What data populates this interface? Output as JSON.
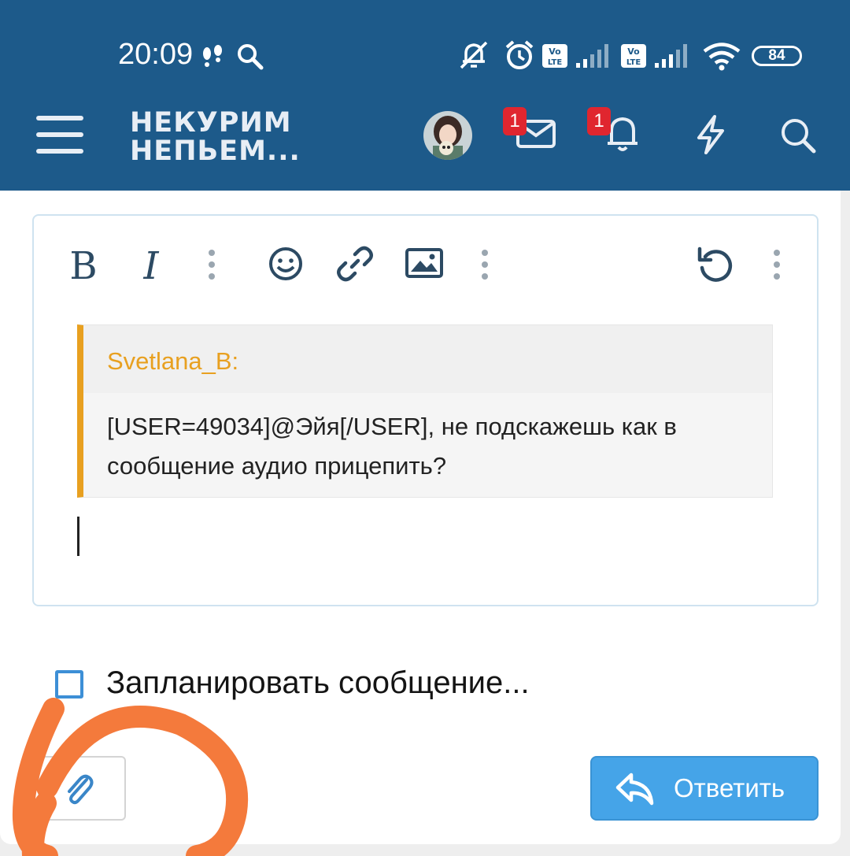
{
  "status_bar": {
    "time": "20:09",
    "battery": "84",
    "icons": [
      "step-counter-icon",
      "search-icon",
      "mute-icon",
      "alarm-icon",
      "volte-icon",
      "signal-icon",
      "volte-icon",
      "signal-icon",
      "wifi-icon",
      "battery-icon"
    ]
  },
  "app_bar": {
    "title_line1": "НЕКУРИМ",
    "title_line2": "НЕПЬЕМ...",
    "messages_badge": "1",
    "alerts_badge": "1",
    "icons": [
      "menu-icon",
      "avatar",
      "envelope-icon",
      "bell-icon",
      "lightning-icon",
      "search-icon"
    ]
  },
  "toolbar": {
    "icons": [
      "bold-icon",
      "italic-icon",
      "more-vertical-icon",
      "smiley-icon",
      "link-icon",
      "image-icon",
      "more-vertical-icon",
      "undo-icon",
      "more-vertical-icon"
    ]
  },
  "quote": {
    "author": "Svetlana_B:",
    "text": "[USER=49034]@Эйя[/USER], не подскажешь как в сообщение аудио прицепить?"
  },
  "schedule": {
    "label": "Запланировать сообщение..."
  },
  "actions": {
    "reply_label": "Ответить"
  },
  "colors": {
    "header_bg": "#1d5a8a",
    "quote_accent": "#e8a020",
    "primary_button": "#45a4e8",
    "checkbox_border": "#3d8fd6",
    "badge": "#e0262f",
    "annotation": "#f47a3c"
  }
}
